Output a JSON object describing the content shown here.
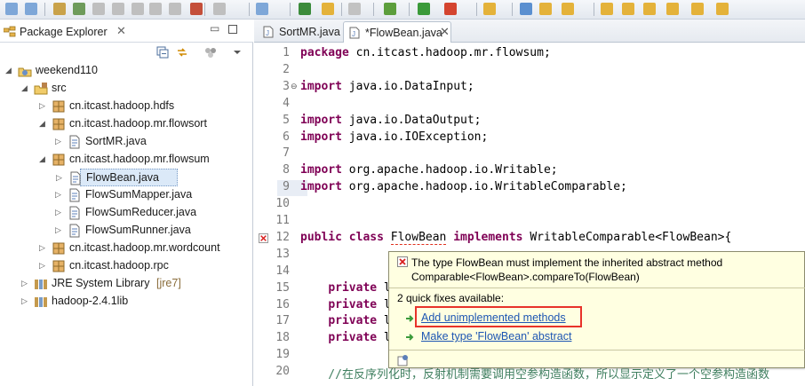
{
  "package_explorer": {
    "title": "Package Explorer",
    "close_glyph": "✕",
    "tree": [
      {
        "label": "weekend110",
        "icon": "java-project-icon",
        "level": 0,
        "expanded": true
      },
      {
        "label": "src",
        "icon": "source-folder-icon",
        "level": 1,
        "expanded": true
      },
      {
        "label": "cn.itcast.hadoop.hdfs",
        "icon": "package-icon",
        "level": 2,
        "expanded": false
      },
      {
        "label": "cn.itcast.hadoop.mr.flowsort",
        "icon": "package-icon",
        "level": 2,
        "expanded": true
      },
      {
        "label": "SortMR.java",
        "icon": "java-file-icon",
        "level": 3,
        "expanded": false
      },
      {
        "label": "cn.itcast.hadoop.mr.flowsum",
        "icon": "package-icon",
        "level": 2,
        "expanded": true
      },
      {
        "label": "FlowBean.java",
        "icon": "java-file-icon",
        "level": 3,
        "expanded": false,
        "selected": true
      },
      {
        "label": "FlowSumMapper.java",
        "icon": "java-file-icon",
        "level": 3,
        "expanded": false
      },
      {
        "label": "FlowSumReducer.java",
        "icon": "java-file-icon",
        "level": 3,
        "expanded": false
      },
      {
        "label": "FlowSumRunner.java",
        "icon": "java-file-icon",
        "level": 3,
        "expanded": false
      },
      {
        "label": "cn.itcast.hadoop.mr.wordcount",
        "icon": "package-icon",
        "level": 2,
        "expanded": false
      },
      {
        "label": "cn.itcast.hadoop.rpc",
        "icon": "package-icon",
        "level": 2,
        "expanded": false
      },
      {
        "label": "JRE System Library",
        "suffix": "[jre7]",
        "icon": "library-icon",
        "level": 1,
        "expanded": false
      },
      {
        "label": "hadoop-2.4.1lib",
        "icon": "library-icon",
        "level": 1,
        "expanded": false
      }
    ]
  },
  "editor": {
    "tabs": [
      {
        "label": "SortMR.java",
        "active": false
      },
      {
        "label": "*FlowBean.java",
        "active": true
      }
    ],
    "close_glyph": "✕",
    "line_numbers": [
      "1",
      "2",
      "3",
      "4",
      "5",
      "6",
      "7",
      "8",
      "9",
      "10",
      "11",
      "12",
      "13",
      "14",
      "15",
      "16",
      "17",
      "18",
      "19",
      "20"
    ],
    "lines": [
      [
        {
          "t": "package",
          "k": "kw"
        },
        {
          "t": " cn.itcast.hadoop.mr.flowsum;"
        }
      ],
      [],
      [
        {
          "t": "import",
          "k": "kw"
        },
        {
          "t": " java.io.DataInput;"
        }
      ],
      [],
      [
        {
          "t": "import",
          "k": "kw"
        },
        {
          "t": " java.io.DataOutput;"
        }
      ],
      [
        {
          "t": "import",
          "k": "kw"
        },
        {
          "t": " java.io.IOException;"
        }
      ],
      [],
      [
        {
          "t": "import",
          "k": "kw"
        },
        {
          "t": " org.apache.hadoop.io.Writable;"
        }
      ],
      [
        {
          "t": "import",
          "k": "kw"
        },
        {
          "t": " org.apache.hadoop.io.WritableComparable;"
        }
      ],
      [],
      [],
      [
        {
          "t": "public",
          "k": "kw"
        },
        {
          "t": " "
        },
        {
          "t": "class",
          "k": "kw"
        },
        {
          "t": " "
        },
        {
          "t": "FlowBean",
          "k": "err"
        },
        {
          "t": " "
        },
        {
          "t": "implements",
          "k": "kw"
        },
        {
          "t": " WritableComparable<FlowBean>{"
        }
      ],
      [],
      [],
      [
        {
          "t": "    "
        },
        {
          "t": "private",
          "k": "kw"
        },
        {
          "t": " l"
        }
      ],
      [
        {
          "t": "    "
        },
        {
          "t": "private",
          "k": "kw"
        },
        {
          "t": " l"
        }
      ],
      [
        {
          "t": "    "
        },
        {
          "t": "private",
          "k": "kw"
        },
        {
          "t": " l"
        }
      ],
      [
        {
          "t": "    "
        },
        {
          "t": "private",
          "k": "kw"
        },
        {
          "t": " l"
        }
      ],
      [],
      [
        {
          "t": "    //在反序列化时，反射机制需要调用空参构造函数，所以显示定义了一个空参构造函数",
          "k": "cm"
        }
      ]
    ]
  },
  "quick_fix": {
    "message_line1": "The type FlowBean must implement the inherited abstract method",
    "message_line2": "Comparable<FlowBean>.compareTo(FlowBean)",
    "count_text": "2 quick fixes available:",
    "fixes": [
      {
        "label": "Add unimplemented methods",
        "highlighted": true
      },
      {
        "label": "Make type 'FlowBean' abstract",
        "highlighted": false
      }
    ]
  },
  "colors": {
    "keyword": "#7f0055",
    "comment": "#3f7f5f",
    "link": "#1e56b3",
    "popup_bg": "#ffffe1",
    "highlight_box": "#e8322a",
    "selection": "#dbe9f8"
  }
}
